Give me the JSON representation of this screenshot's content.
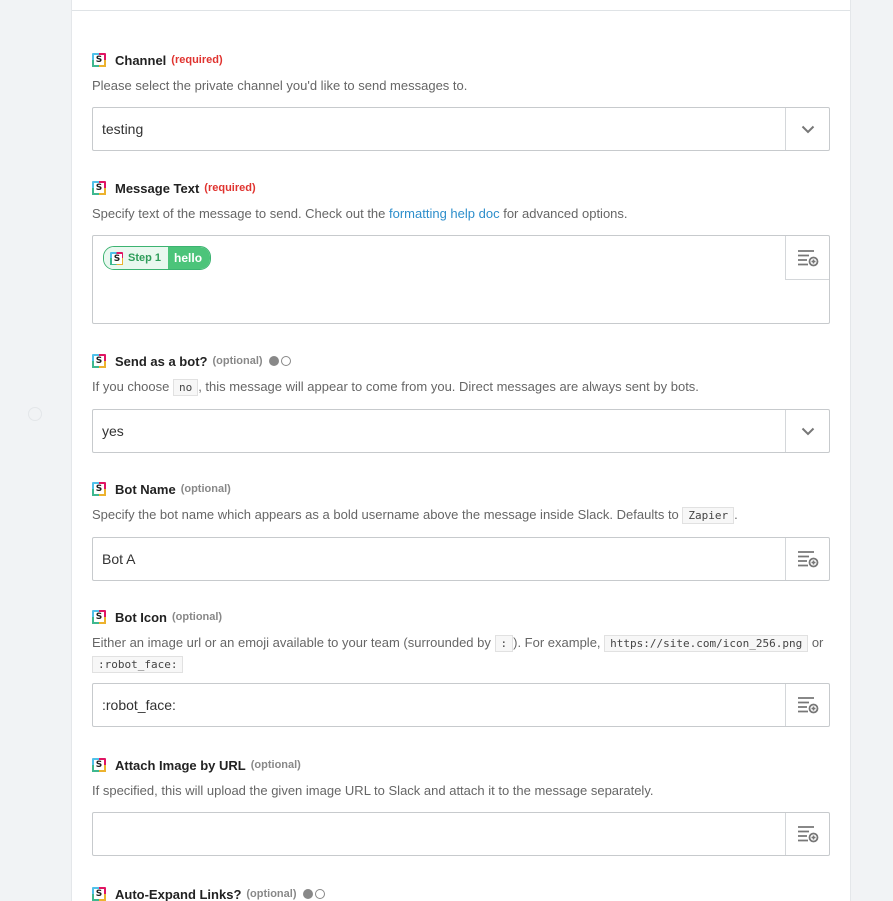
{
  "fields": [
    {
      "label": "Channel",
      "tag": "(required)",
      "help": "Please select the private channel you'd like to send messages to.",
      "value": "testing",
      "control": "dropdown"
    },
    {
      "label": "Message Text",
      "tag": "(required)",
      "help_before": "Specify text of the message to send. Check out the ",
      "help_link": "formatting help doc",
      "help_after": " for advanced options.",
      "pill": {
        "step_label": "Step 1",
        "value": "hello"
      },
      "control": "textarea-insert"
    },
    {
      "label": "Send as a bot?",
      "tag": "(optional)",
      "help_before": "If you choose ",
      "help_code": "no",
      "help_after": ", this message will appear to come from you. Direct messages are always sent by bots.",
      "value": "yes",
      "control": "dropdown"
    },
    {
      "label": "Bot Name",
      "tag": "(optional)",
      "help_before": "Specify the bot name which appears as a bold username above the message inside Slack. Defaults to ",
      "help_code": "Zapier",
      "help_after": ".",
      "value": "Bot A",
      "control": "insert"
    },
    {
      "label": "Bot Icon",
      "tag": "(optional)",
      "help_1": "Either an image url or an emoji available to your team (surrounded by ",
      "help_code_1": ":",
      "help_2": "). For example, ",
      "help_code_2": "https://site.com/icon_256.png",
      "help_3": " or ",
      "help_code_3": ":robot_face:",
      "value": ":robot_face:",
      "control": "insert"
    },
    {
      "label": "Attach Image by URL",
      "tag": "(optional)",
      "help": "If specified, this will upload the given image URL to Slack and attach it to the message separately.",
      "value": "",
      "control": "insert"
    },
    {
      "label": "Auto-Expand Links?",
      "tag": "(optional)"
    }
  ],
  "icons": {
    "app": "slack-icon",
    "dropdown": "chevron-down-icon",
    "insert": "insert-field-icon"
  },
  "colors": {
    "required": "#e0332f",
    "link": "#2d8ecb",
    "pill": "#4cc47a"
  }
}
